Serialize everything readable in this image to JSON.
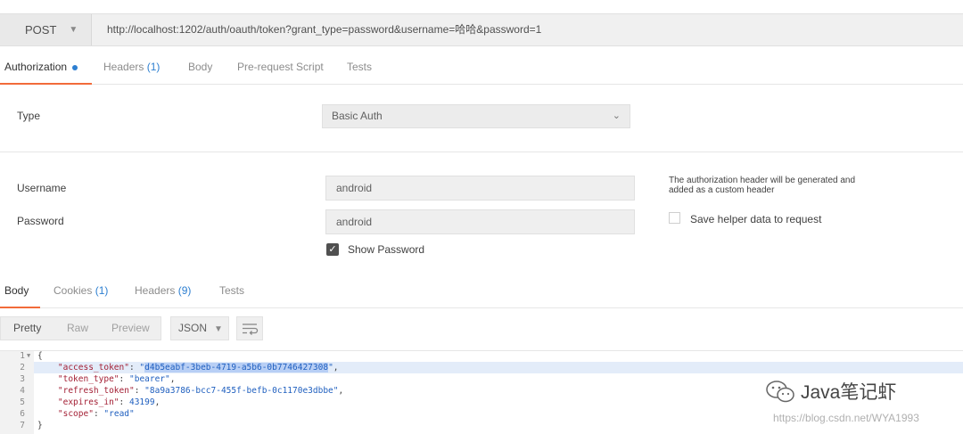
{
  "request": {
    "method": "POST",
    "url": "http://localhost:1202/auth/oauth/token?grant_type=password&username=哈哈&password=1"
  },
  "request_tabs": [
    {
      "label": "Authorization",
      "count": ""
    },
    {
      "label": "Headers",
      "count": "(1)"
    },
    {
      "label": "Body",
      "count": ""
    },
    {
      "label": "Pre-request Script",
      "count": ""
    },
    {
      "label": "Tests",
      "count": ""
    }
  ],
  "auth": {
    "type_label": "Type",
    "type_value": "Basic Auth",
    "username_label": "Username",
    "username_value": "android",
    "password_label": "Password",
    "password_value": "android",
    "show_password_label": "Show Password",
    "show_password_checked": true,
    "helper_note": "The authorization header will be generated and added as a custom header",
    "save_helper_label": "Save helper data to request",
    "save_helper_checked": false
  },
  "response_tabs": [
    {
      "label": "Body",
      "count": ""
    },
    {
      "label": "Cookies",
      "count": "(1)"
    },
    {
      "label": "Headers",
      "count": "(9)"
    },
    {
      "label": "Tests",
      "count": ""
    }
  ],
  "body_toolbar": {
    "formats": [
      "Pretty",
      "Raw",
      "Preview"
    ],
    "active_format": "Pretty",
    "language": "JSON"
  },
  "response_body": {
    "line_numbers": [
      "1",
      "2",
      "3",
      "4",
      "5",
      "6",
      "7"
    ],
    "open_brace": "{",
    "close_brace": "}",
    "fields": [
      {
        "key": "\"access_token\"",
        "value": "d4b5eabf-3beb-4719-a5b6-0b7746427308",
        "type": "string",
        "comma": ","
      },
      {
        "key": "\"token_type\"",
        "value": "bearer",
        "type": "string",
        "comma": ","
      },
      {
        "key": "\"refresh_token\"",
        "value": "8a9a3786-bcc7-455f-befb-0c1170e3dbbe",
        "type": "string",
        "comma": ","
      },
      {
        "key": "\"expires_in\"",
        "value": "43199",
        "type": "number",
        "comma": ","
      },
      {
        "key": "\"scope\"",
        "value": "read",
        "type": "string",
        "comma": ""
      }
    ]
  },
  "watermark": {
    "text": "Java笔记虾",
    "url": "https://blog.csdn.net/WYA1993"
  },
  "colors": {
    "accent": "#f26b3a",
    "link_blue": "#2d7fd1",
    "json_key": "#a31f34",
    "json_string": "#1f5fbf"
  }
}
